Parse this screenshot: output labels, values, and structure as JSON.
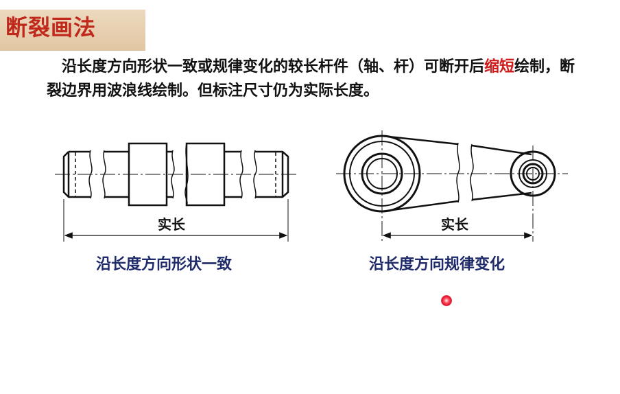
{
  "title": "断裂画法",
  "paragraph": {
    "indent": "　",
    "part1": "沿长度方向形状一致或规律变化的较长杆件（轴、杆）可断开后",
    "highlight": "缩短",
    "part2": "绘制，断裂边界用波浪线绘制。但标注尺寸仍为实际长度。"
  },
  "figures": {
    "left": {
      "dimension_label": "实长",
      "caption": "沿长度方向形状一致"
    },
    "right": {
      "dimension_label": "实长",
      "caption": "沿长度方向规律变化"
    }
  },
  "colors": {
    "title": "#c0281b",
    "title_bg": "#e6cdb0",
    "highlight": "#d01a1a",
    "caption": "#1f2a6b",
    "laser": "#e0102a"
  }
}
